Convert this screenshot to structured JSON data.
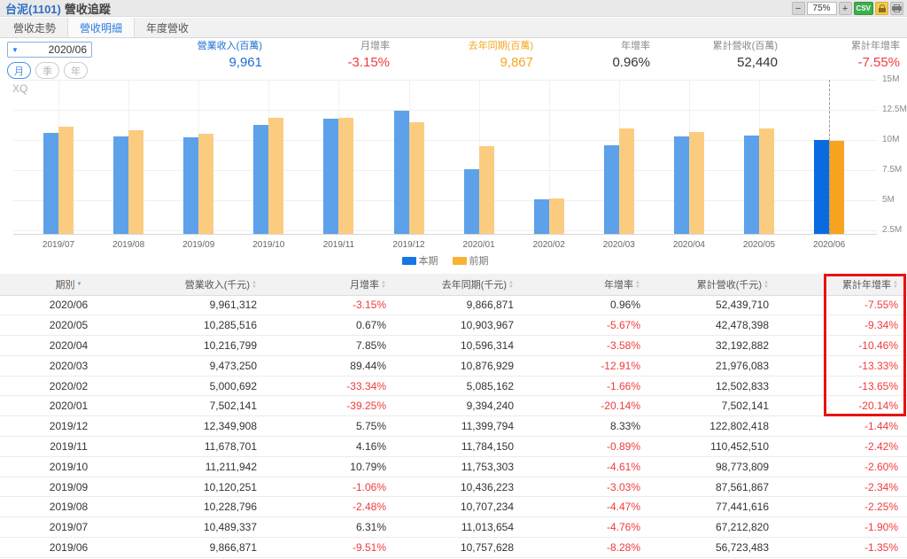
{
  "header": {
    "title_stock": "台泥(1101)",
    "title_rest": "營收追蹤",
    "zoom_out": "−",
    "zoom_level": "75%",
    "zoom_in": "+",
    "csv_label": "CSV"
  },
  "tabs": [
    {
      "label": "營收走勢",
      "active": false
    },
    {
      "label": "營收明細",
      "active": true
    },
    {
      "label": "年度營收",
      "active": false
    }
  ],
  "controls": {
    "period_value": "2020/06",
    "caret": "▼",
    "period_buttons": [
      {
        "label": "月",
        "active": true
      },
      {
        "label": "季",
        "active": false
      },
      {
        "label": "年",
        "active": false
      }
    ]
  },
  "stats": [
    {
      "label": "營業收入(百萬)",
      "value": "9,961",
      "tone": "blue",
      "right": 296
    },
    {
      "label": "月增率",
      "value": "-3.15%",
      "tone": "red",
      "right": 440
    },
    {
      "label": "去年同期(百萬)",
      "value": "9,867",
      "tone": "orange",
      "right": 602
    },
    {
      "label": "年增率",
      "value": "0.96%",
      "tone": "dark",
      "right": 734
    },
    {
      "label": "累計營收(百萬)",
      "value": "52,440",
      "tone": "dark",
      "right": 878
    },
    {
      "label": "累計年增率",
      "value": "-7.55%",
      "tone": "red",
      "right": 1016
    }
  ],
  "chart_data": {
    "type": "bar",
    "watermark": "XQ",
    "categories": [
      "2019/07",
      "2019/08",
      "2019/09",
      "2019/10",
      "2019/11",
      "2019/12",
      "2020/01",
      "2020/02",
      "2020/03",
      "2020/04",
      "2020/05",
      "2020/06"
    ],
    "series": [
      {
        "name": "本期",
        "color": "#5da1ea",
        "highlight_color": "#0a6be0",
        "values": [
          10489337,
          10228796,
          10120251,
          11211942,
          11678701,
          12349908,
          7502141,
          5000692,
          9473250,
          10216799,
          10285516,
          9961312
        ]
      },
      {
        "name": "前期",
        "color": "#fbcc80",
        "highlight_color": "#f6a41f",
        "values": [
          11013654,
          10707234,
          10436223,
          11753303,
          11784150,
          11399794,
          9394240,
          5085162,
          10876929,
          10596314,
          10903967,
          9866871
        ]
      }
    ],
    "unit": "千元",
    "y_ticks": [
      {
        "value": 15000000,
        "label": "15M"
      },
      {
        "value": 12500000,
        "label": "12.5M"
      },
      {
        "value": 10000000,
        "label": "10M"
      },
      {
        "value": 7500000,
        "label": "7.5M"
      },
      {
        "value": 5000000,
        "label": "5M"
      },
      {
        "value": 2500000,
        "label": "2.5M"
      }
    ],
    "ylim": [
      2130000,
      15000000
    ],
    "highlight_index": 11,
    "grid": true,
    "legend_position": "bottom-center"
  },
  "table": {
    "columns": [
      {
        "label": "期別",
        "sorted": true
      },
      {
        "label": "營業收入(千元)",
        "sorted": false
      },
      {
        "label": "月增率",
        "sorted": false
      },
      {
        "label": "去年同期(千元)",
        "sorted": false
      },
      {
        "label": "年增率",
        "sorted": false
      },
      {
        "label": "累計營收(千元)",
        "sorted": false
      },
      {
        "label": "累計年增率",
        "sorted": false
      }
    ],
    "rows": [
      [
        "2020/06",
        "9,961,312",
        "-3.15%",
        "9,866,871",
        "0.96%",
        "52,439,710",
        "-7.55%"
      ],
      [
        "2020/05",
        "10,285,516",
        "0.67%",
        "10,903,967",
        "-5.67%",
        "42,478,398",
        "-9.34%"
      ],
      [
        "2020/04",
        "10,216,799",
        "7.85%",
        "10,596,314",
        "-3.58%",
        "32,192,882",
        "-10.46%"
      ],
      [
        "2020/03",
        "9,473,250",
        "89.44%",
        "10,876,929",
        "-12.91%",
        "21,976,083",
        "-13.33%"
      ],
      [
        "2020/02",
        "5,000,692",
        "-33.34%",
        "5,085,162",
        "-1.66%",
        "12,502,833",
        "-13.65%"
      ],
      [
        "2020/01",
        "7,502,141",
        "-39.25%",
        "9,394,240",
        "-20.14%",
        "7,502,141",
        "-20.14%"
      ],
      [
        "2019/12",
        "12,349,908",
        "5.75%",
        "11,399,794",
        "8.33%",
        "122,802,418",
        "-1.44%"
      ],
      [
        "2019/11",
        "11,678,701",
        "4.16%",
        "11,784,150",
        "-0.89%",
        "110,452,510",
        "-2.42%"
      ],
      [
        "2019/10",
        "11,211,942",
        "10.79%",
        "11,753,303",
        "-4.61%",
        "98,773,809",
        "-2.60%"
      ],
      [
        "2019/09",
        "10,120,251",
        "-1.06%",
        "10,436,223",
        "-3.03%",
        "87,561,867",
        "-2.34%"
      ],
      [
        "2019/08",
        "10,228,796",
        "-2.48%",
        "10,707,234",
        "-4.47%",
        "77,441,616",
        "-2.25%"
      ],
      [
        "2019/07",
        "10,489,337",
        "6.31%",
        "11,013,654",
        "-4.76%",
        "67,212,820",
        "-1.90%"
      ],
      [
        "2019/06",
        "9,866,871",
        "-9.51%",
        "10,757,628",
        "-8.28%",
        "56,723,483",
        "-1.35%"
      ]
    ],
    "highlight_column": 6,
    "highlight_row_count": 6
  }
}
